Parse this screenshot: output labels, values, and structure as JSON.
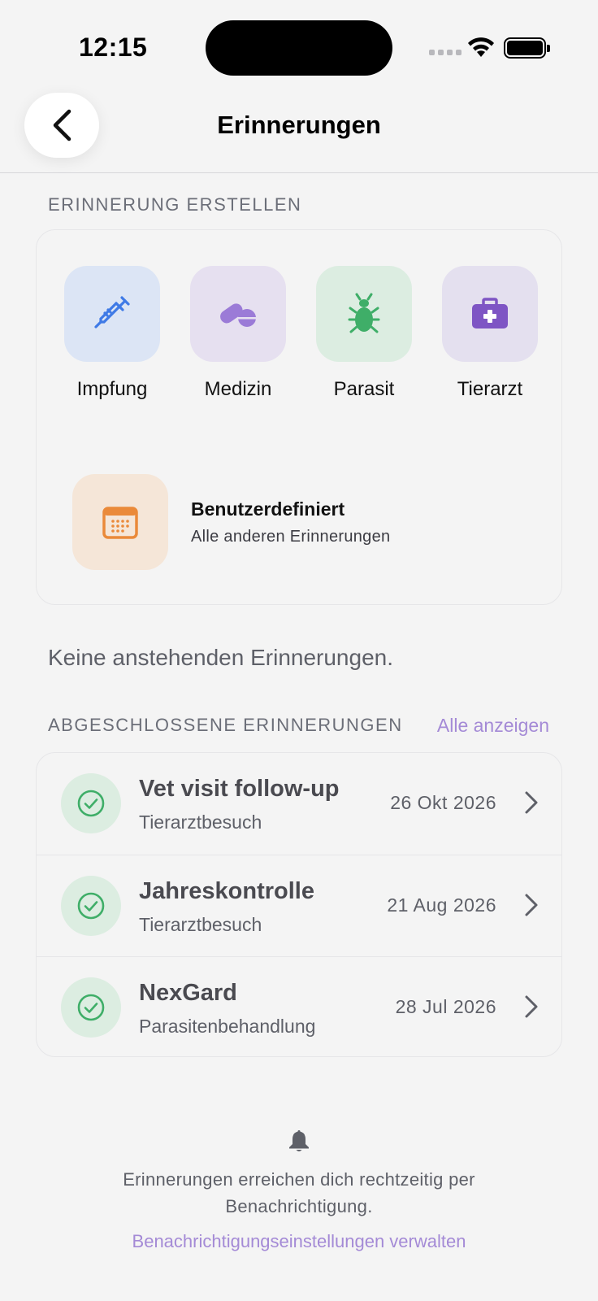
{
  "status_bar": {
    "time": "12:15"
  },
  "nav": {
    "title": "Erinnerungen"
  },
  "create_section": {
    "label": "ERINNERUNG ERSTELLEN",
    "types": [
      {
        "label": "Impfung",
        "icon": "syringe-icon",
        "bg": "#dce5f5",
        "color": "#3f7ae6"
      },
      {
        "label": "Medizin",
        "icon": "pills-icon",
        "bg": "#e6e0f0",
        "color": "#9b7bd7"
      },
      {
        "label": "Parasit",
        "icon": "bug-icon",
        "bg": "#dcede1",
        "color": "#3fae68"
      },
      {
        "label": "Tierarzt",
        "icon": "medkit-icon",
        "bg": "#e4e0ef",
        "color": "#7e55c4"
      }
    ],
    "custom": {
      "title": "Benutzerdefiniert",
      "subtitle": "Alle anderen Erinnerungen",
      "icon": "calendar-icon",
      "bg": "#f5e6d8",
      "color": "#ea8a3a"
    }
  },
  "upcoming": {
    "empty_text": "Keine anstehenden Erinnerungen."
  },
  "completed": {
    "label": "ABGESCHLOSSENE ERINNERUNGEN",
    "see_all": "Alle anzeigen",
    "items": [
      {
        "title": "Vet visit follow-up",
        "subtitle": "Tierarztbesuch",
        "date": "26 Okt 2026"
      },
      {
        "title": "Jahreskontrolle",
        "subtitle": "Tierarztbesuch",
        "date": "21 Aug 2026"
      },
      {
        "title": "NexGard",
        "subtitle": "Parasitenbehandlung",
        "date": "28 Jul 2026"
      }
    ]
  },
  "footer": {
    "text": "Erinnerungen erreichen dich rechtzeitig per Benachrichtigung.",
    "link": "Benachrichtigungseinstellungen verwalten"
  }
}
